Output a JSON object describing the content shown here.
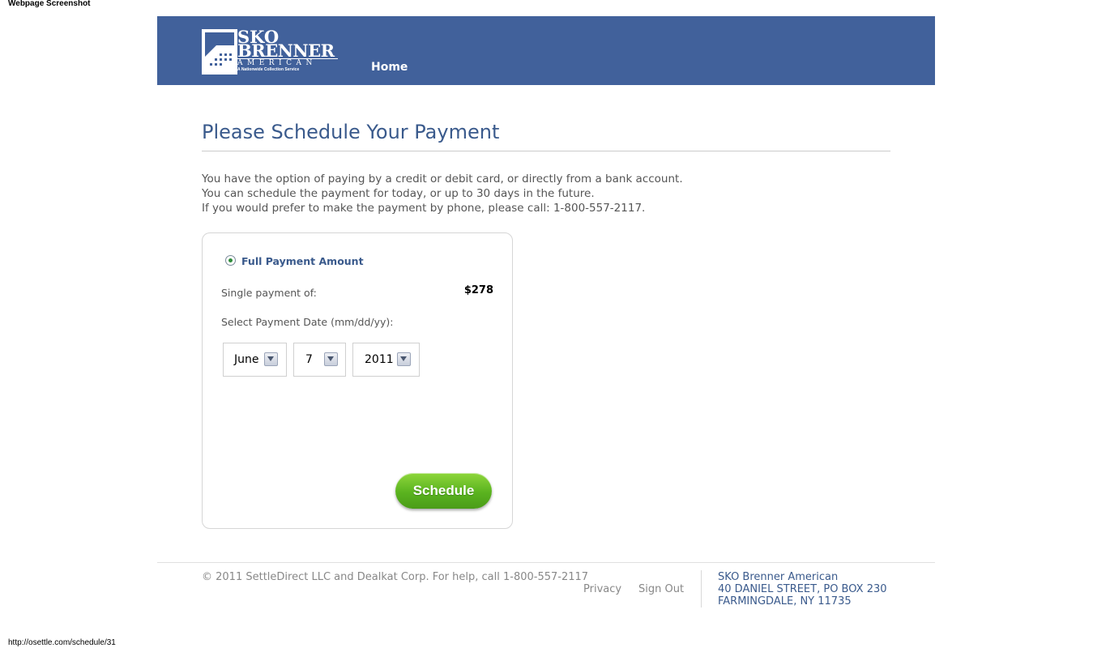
{
  "browser": {
    "caption": "Webpage Screenshot",
    "url": "http://osettle.com/schedule/31"
  },
  "header": {
    "logo": {
      "line1": "SKO",
      "line2": "BRENNER",
      "line3": "AMERICAN",
      "tagline": "A Nationwide Collection Service"
    },
    "nav": {
      "home": "Home"
    },
    "background_color": "#41619b"
  },
  "main": {
    "title": "Please Schedule Your Payment",
    "intro": [
      "You have the option of paying by a credit or debit card, or directly from a bank account.",
      "You can schedule the payment for today, or up to 30 days in the future.",
      "If you would prefer to make the payment by phone, please call: 1-800-557-2117."
    ]
  },
  "payment_card": {
    "option_label": "Full Payment Amount",
    "option_selected": true,
    "single_payment_label": "Single payment of:",
    "amount": "$278",
    "date_label": "Select Payment Date (mm/dd/yy):",
    "month": "June",
    "day": "7",
    "year": "2011",
    "schedule_button": "Schedule",
    "button_color": "#5ab31f"
  },
  "footer": {
    "copyright": "© 2011 SettleDirect LLC and Dealkat Corp. For help, call 1-800-557-2117",
    "links": {
      "privacy": "Privacy",
      "sign_out": "Sign Out"
    },
    "address": {
      "name": "SKO Brenner American",
      "street": "40 DANIEL STREET, PO BOX 230",
      "city": "FARMINGDALE, NY 11735"
    }
  }
}
